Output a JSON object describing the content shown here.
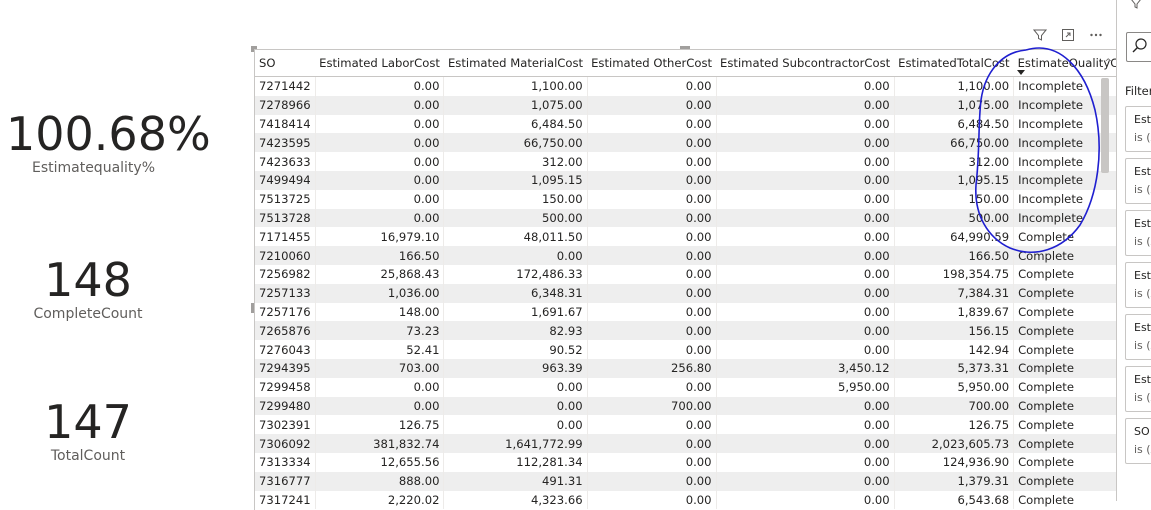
{
  "kpis": [
    {
      "value": "100.68%",
      "label": "Estimatequality%"
    },
    {
      "value": "148",
      "label": "CompleteCount"
    },
    {
      "value": "147",
      "label": "TotalCount"
    }
  ],
  "table": {
    "columns": [
      "SO",
      "Estimated LaborCost",
      "Estimated MaterialCost",
      "Estimated OtherCost",
      "Estimated SubcontractorCost",
      "EstimatedTotalCost",
      "EstimateQualityChec"
    ],
    "rows": [
      [
        "7271442",
        "0.00",
        "1,100.00",
        "0.00",
        "0.00",
        "1,100.00",
        "Incomplete"
      ],
      [
        "7278966",
        "0.00",
        "1,075.00",
        "0.00",
        "0.00",
        "1,075.00",
        "Incomplete"
      ],
      [
        "7418414",
        "0.00",
        "6,484.50",
        "0.00",
        "0.00",
        "6,484.50",
        "Incomplete"
      ],
      [
        "7423595",
        "0.00",
        "66,750.00",
        "0.00",
        "0.00",
        "66,750.00",
        "Incomplete"
      ],
      [
        "7423633",
        "0.00",
        "312.00",
        "0.00",
        "0.00",
        "312.00",
        "Incomplete"
      ],
      [
        "7499494",
        "0.00",
        "1,095.15",
        "0.00",
        "0.00",
        "1,095.15",
        "Incomplete"
      ],
      [
        "7513725",
        "0.00",
        "150.00",
        "0.00",
        "0.00",
        "150.00",
        "Incomplete"
      ],
      [
        "7513728",
        "0.00",
        "500.00",
        "0.00",
        "0.00",
        "500.00",
        "Incomplete"
      ],
      [
        "7171455",
        "16,979.10",
        "48,011.50",
        "0.00",
        "0.00",
        "64,990.59",
        "Complete"
      ],
      [
        "7210060",
        "166.50",
        "0.00",
        "0.00",
        "0.00",
        "166.50",
        "Complete"
      ],
      [
        "7256982",
        "25,868.43",
        "172,486.33",
        "0.00",
        "0.00",
        "198,354.75",
        "Complete"
      ],
      [
        "7257133",
        "1,036.00",
        "6,348.31",
        "0.00",
        "0.00",
        "7,384.31",
        "Complete"
      ],
      [
        "7257176",
        "148.00",
        "1,691.67",
        "0.00",
        "0.00",
        "1,839.67",
        "Complete"
      ],
      [
        "7265876",
        "73.23",
        "82.93",
        "0.00",
        "0.00",
        "156.15",
        "Complete"
      ],
      [
        "7276043",
        "52.41",
        "90.52",
        "0.00",
        "0.00",
        "142.94",
        "Complete"
      ],
      [
        "7294395",
        "703.00",
        "963.39",
        "256.80",
        "3,450.12",
        "5,373.31",
        "Complete"
      ],
      [
        "7299458",
        "0.00",
        "0.00",
        "0.00",
        "5,950.00",
        "5,950.00",
        "Complete"
      ],
      [
        "7299480",
        "0.00",
        "0.00",
        "700.00",
        "0.00",
        "700.00",
        "Complete"
      ],
      [
        "7302391",
        "126.75",
        "0.00",
        "0.00",
        "0.00",
        "126.75",
        "Complete"
      ],
      [
        "7306092",
        "381,832.74",
        "1,641,772.99",
        "0.00",
        "0.00",
        "2,023,605.73",
        "Complete"
      ],
      [
        "7313334",
        "12,655.56",
        "112,281.34",
        "0.00",
        "0.00",
        "124,936.90",
        "Complete"
      ],
      [
        "7316777",
        "888.00",
        "491.31",
        "0.00",
        "0.00",
        "1,379.31",
        "Complete"
      ],
      [
        "7317241",
        "2,220.02",
        "4,323.66",
        "0.00",
        "0.00",
        "6,543.68",
        "Complete"
      ]
    ]
  },
  "filter_pane": {
    "top_icon": "filter-icon",
    "search_icon": "search-icon",
    "label": "Filter",
    "cards": [
      {
        "line1": "Esti",
        "line2": "is (A"
      },
      {
        "line1": "Esti",
        "line2": "is (A"
      },
      {
        "line1": "Esti",
        "line2": "is (A"
      },
      {
        "line1": "Esti",
        "line2": "is (A"
      },
      {
        "line1": "Esti",
        "line2": "is (A"
      },
      {
        "line1": "Esti",
        "line2": "is (A"
      },
      {
        "line1": "SO",
        "line2": "is (A"
      }
    ]
  },
  "header_icons": [
    "filter-icon",
    "focus-mode-icon",
    "more-options-icon"
  ],
  "colors": {
    "annotation": "#1f1fd0",
    "alt_row": "#eeeeee",
    "border": "#c8c6c4"
  }
}
